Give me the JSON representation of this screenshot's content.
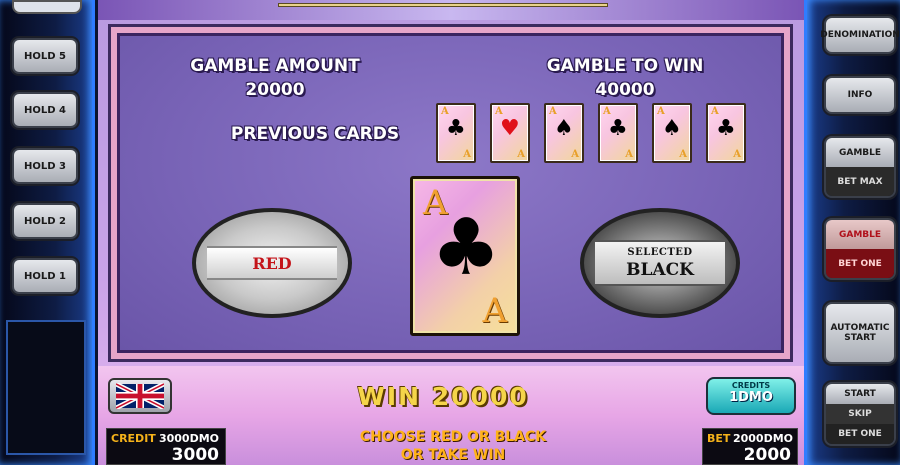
{
  "left_panel": {
    "hold_buttons": [
      "HOLD 5",
      "HOLD 4",
      "HOLD 3",
      "HOLD 2",
      "HOLD 1"
    ]
  },
  "right_panel": {
    "denomination": "DENOMINATION",
    "info": "INFO",
    "gamble_max_top": "GAMBLE",
    "gamble_max_bottom": "BET MAX",
    "gamble_one_top": "GAMBLE",
    "gamble_one_bottom": "BET ONE",
    "automatic_start": "AUTOMATIC START",
    "start": "START",
    "skip": "SKIP",
    "bet_one": "BET ONE"
  },
  "gamble": {
    "amount_label": "GAMBLE AMOUNT",
    "amount_value": "20000",
    "to_win_label": "GAMBLE TO WIN",
    "to_win_value": "40000",
    "previous_label": "PREVIOUS CARDS",
    "previous_cards": [
      {
        "suit": "clubs",
        "rank": "A"
      },
      {
        "suit": "hearts",
        "rank": "A"
      },
      {
        "suit": "spades",
        "rank": "A"
      },
      {
        "suit": "clubs",
        "rank": "A"
      },
      {
        "suit": "spades",
        "rank": "A"
      },
      {
        "suit": "clubs",
        "rank": "A"
      }
    ],
    "current_card": {
      "suit": "clubs",
      "rank": "A"
    },
    "red_label": "RED",
    "black_label": "BLACK",
    "selected_label": "SELECTED"
  },
  "bottom": {
    "win_text": "WIN 20000",
    "message_line1": "CHOOSE RED OR BLACK",
    "message_line2": "OR TAKE WIN",
    "credits_label": "CREDITS",
    "credits_value": "1DMO",
    "credit_label": "CREDIT",
    "credit_dmo": "3000DMO",
    "credit_value": "3000",
    "bet_label": "BET",
    "bet_dmo": "2000DMO",
    "bet_value": "2000"
  },
  "colors": {
    "accent_gold": "#f5d54a",
    "red_suit": "#e0101a",
    "frame_purple": "#7863b6"
  }
}
